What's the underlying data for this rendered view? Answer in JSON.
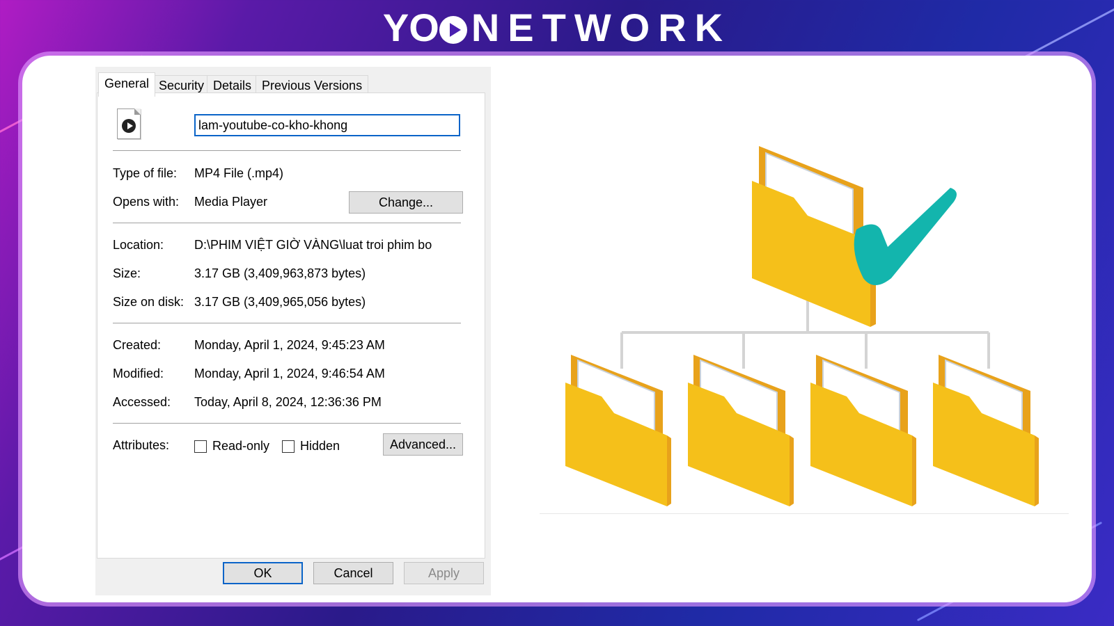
{
  "brand": {
    "logo_text": "NETWORK",
    "logo_prefix": "YO"
  },
  "dialog": {
    "tabs": [
      {
        "label": "General",
        "active": true
      },
      {
        "label": "Security",
        "active": false
      },
      {
        "label": "Details",
        "active": false
      },
      {
        "label": "Previous Versions",
        "active": false
      }
    ],
    "file_icon": "media-file-icon",
    "file_name": "lam-youtube-co-kho-khong",
    "rows": {
      "type_label": "Type of file:",
      "type_value": "MP4 File (.mp4)",
      "opens_label": "Opens with:",
      "opens_value": "Media Player",
      "change_button": "Change...",
      "location_label": "Location:",
      "location_value": "D:\\PHIM VIỆT GIỜ VÀNG\\luat troi phim bo",
      "size_label": "Size:",
      "size_value": "3.17 GB (3,409,963,873 bytes)",
      "size_disk_label": "Size on disk:",
      "size_disk_value": "3.17 GB (3,409,965,056 bytes)",
      "created_label": "Created:",
      "created_value": "Monday, April 1, 2024, 9:45:23 AM",
      "modified_label": "Modified:",
      "modified_value": "Monday, April 1, 2024, 9:46:54 AM",
      "accessed_label": "Accessed:",
      "accessed_value": "Today, April 8, 2024, 12:36:36 PM",
      "attributes_label": "Attributes:",
      "readonly_label": "Read-only",
      "readonly_checked": false,
      "hidden_label": "Hidden",
      "hidden_checked": false,
      "advanced_button": "Advanced..."
    },
    "buttons": {
      "ok": "OK",
      "cancel": "Cancel",
      "apply": "Apply"
    }
  },
  "illustration": {
    "parent_icon": "folder-with-checkmark-icon",
    "child_icons": [
      "folder-icon",
      "folder-icon",
      "folder-icon",
      "folder-icon"
    ],
    "colors": {
      "folder": "#f5c01a",
      "folder_dark": "#e8a21b",
      "check": "#13b5ad"
    }
  },
  "colors": {
    "accent": "#0a64c8",
    "bg_purple": "#5a1aa8",
    "bg_blue": "#1f2aa6"
  }
}
